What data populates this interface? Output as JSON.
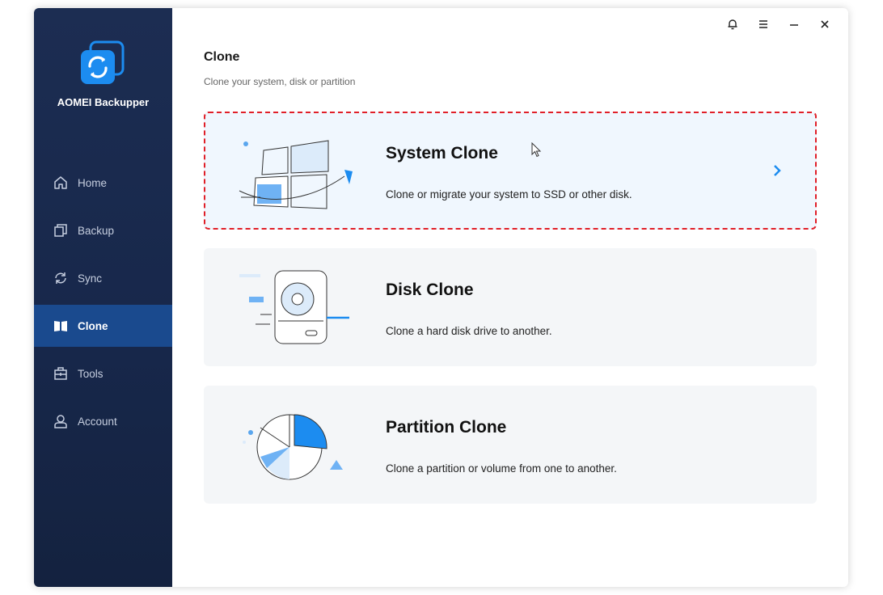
{
  "app": {
    "name": "AOMEI Backupper",
    "brand_color": "#1c8cf0",
    "accent_color": "#1a4a8e"
  },
  "sidebar": {
    "items": [
      {
        "label": "Home",
        "icon": "home-icon"
      },
      {
        "label": "Backup",
        "icon": "backup-icon"
      },
      {
        "label": "Sync",
        "icon": "sync-icon"
      },
      {
        "label": "Clone",
        "icon": "clone-icon",
        "active": true
      },
      {
        "label": "Tools",
        "icon": "tools-icon"
      },
      {
        "label": "Account",
        "icon": "account-icon"
      }
    ]
  },
  "titlebar": {
    "icons": [
      "bell-icon",
      "menu-icon",
      "minimize-icon",
      "close-icon"
    ]
  },
  "main": {
    "title": "Clone",
    "subtitle": "Clone your system, disk or partition",
    "cards": [
      {
        "title": "System Clone",
        "desc": "Clone or migrate your system to SSD or other disk.",
        "selected": true,
        "icon": "system-clone-illustration"
      },
      {
        "title": "Disk Clone",
        "desc": "Clone a hard disk drive to another.",
        "icon": "disk-clone-illustration"
      },
      {
        "title": "Partition Clone",
        "desc": "Clone a partition or volume from one to another.",
        "icon": "partition-clone-illustration"
      }
    ]
  }
}
